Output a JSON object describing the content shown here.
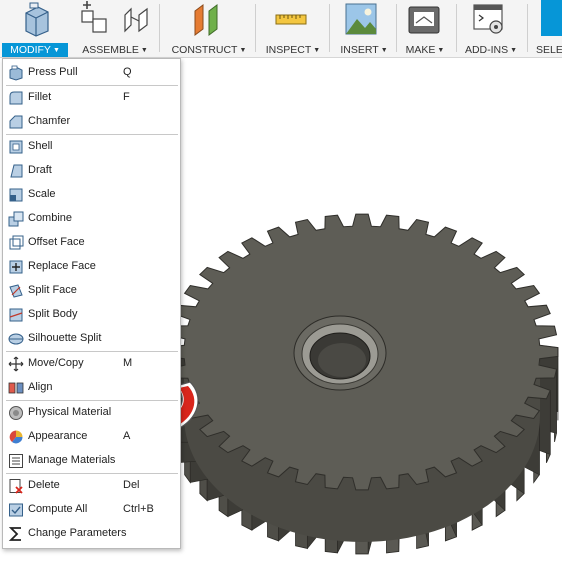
{
  "toolbar": {
    "groups": [
      {
        "label": "MODIFY",
        "active": true
      },
      {
        "label": "ASSEMBLE"
      },
      {
        "label": "CONSTRUCT"
      },
      {
        "label": "INSPECT"
      },
      {
        "label": "INSERT"
      },
      {
        "label": "MAKE"
      },
      {
        "label": "ADD-INS"
      },
      {
        "label": "SELE"
      }
    ],
    "icons": [
      "press-pull-icon",
      "new-component-icon",
      "joint-icon",
      "offset-plane-icon",
      "measure-icon",
      "insert-image-icon",
      "3d-print-icon",
      "scripts-icon",
      "select-icon"
    ]
  },
  "menu": {
    "items": [
      {
        "label": "Press Pull",
        "shortcut": "Q",
        "icon": "press-pull-icon"
      },
      {
        "label": "Fillet",
        "shortcut": "F",
        "icon": "fillet-icon"
      },
      {
        "label": "Chamfer",
        "shortcut": "",
        "icon": "chamfer-icon"
      },
      {
        "label": "Shell",
        "shortcut": "",
        "icon": "shell-icon"
      },
      {
        "label": "Draft",
        "shortcut": "",
        "icon": "draft-icon"
      },
      {
        "label": "Scale",
        "shortcut": "",
        "icon": "scale-icon"
      },
      {
        "label": "Combine",
        "shortcut": "",
        "icon": "combine-icon"
      },
      {
        "label": "Offset Face",
        "shortcut": "",
        "icon": "offset-face-icon"
      },
      {
        "label": "Replace Face",
        "shortcut": "",
        "icon": "replace-face-icon"
      },
      {
        "label": "Split Face",
        "shortcut": "",
        "icon": "split-face-icon"
      },
      {
        "label": "Split Body",
        "shortcut": "",
        "icon": "split-body-icon"
      },
      {
        "label": "Silhouette Split",
        "shortcut": "",
        "icon": "silhouette-split-icon"
      },
      {
        "label": "Move/Copy",
        "shortcut": "M",
        "icon": "move-icon"
      },
      {
        "label": "Align",
        "shortcut": "",
        "icon": "align-icon"
      },
      {
        "label": "Physical Material",
        "shortcut": "",
        "icon": "physical-material-icon"
      },
      {
        "label": "Appearance",
        "shortcut": "A",
        "icon": "appearance-icon"
      },
      {
        "label": "Manage Materials",
        "shortcut": "",
        "icon": "manage-materials-icon"
      },
      {
        "label": "Delete",
        "shortcut": "Del",
        "icon": "delete-icon"
      },
      {
        "label": "Compute All",
        "shortcut": "Ctrl+B",
        "icon": "compute-all-icon"
      },
      {
        "label": "Change Parameters",
        "shortcut": "",
        "icon": "change-parameters-icon"
      }
    ]
  },
  "colors": {
    "accent": "#0696d7",
    "gear": "#5e5d56",
    "arrow": "#d9261c"
  }
}
